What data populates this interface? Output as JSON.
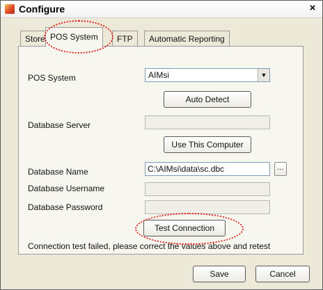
{
  "window": {
    "title": "Configure",
    "close_glyph": "×",
    "app_icon": "configure-app-icon"
  },
  "tabs": [
    {
      "label": "Store",
      "active": false
    },
    {
      "label": "POS System",
      "active": true
    },
    {
      "label": "FTP",
      "active": false
    },
    {
      "label": "Automatic Reporting",
      "active": false
    }
  ],
  "form": {
    "pos_system_label": "POS System",
    "pos_system_value": "AIMsi",
    "auto_detect_label": "Auto Detect",
    "database_server_label": "Database Server",
    "database_server_value": "",
    "use_this_computer_label": "Use This Computer",
    "database_name_label": "Database Name",
    "database_name_value": "C:\\AIMsi\\data\\sc.dbc",
    "browse_label": "...",
    "database_username_label": "Database Username",
    "database_username_value": "",
    "database_password_label": "Database Password",
    "database_password_value": "",
    "test_connection_label": "Test Connection",
    "status_message": "Connection test failed, please correct the values above and retest"
  },
  "footer": {
    "save_label": "Save",
    "cancel_label": "Cancel"
  },
  "colors": {
    "highlight": "#e0201a",
    "window_bg": "#ece9d8",
    "panel_bg": "#f7f6ef"
  }
}
